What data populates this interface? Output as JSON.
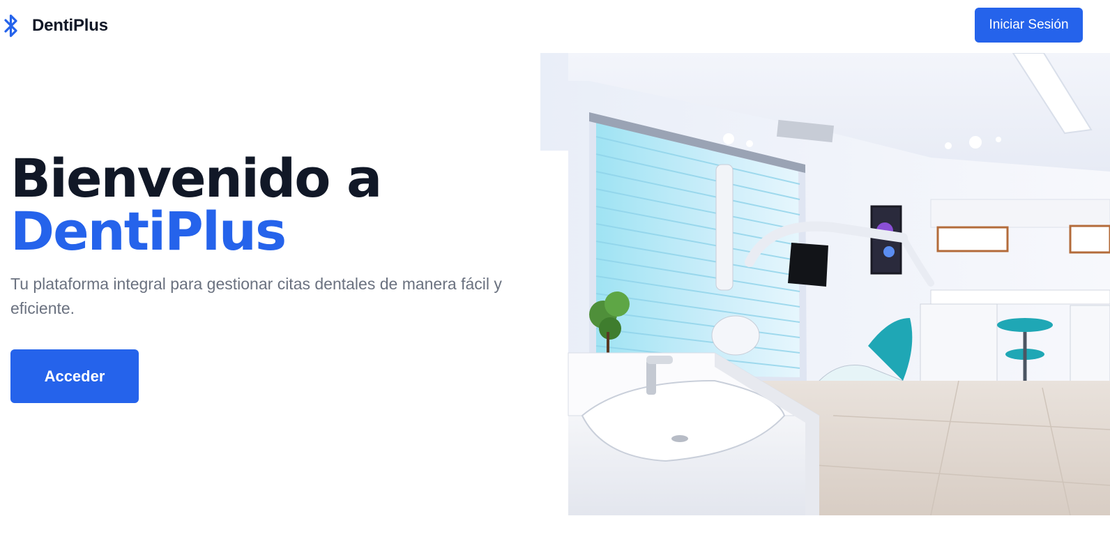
{
  "header": {
    "brand_name": "DentiPlus",
    "brand_icon": "bluetooth-icon",
    "login_label": "Iniciar Sesión"
  },
  "hero": {
    "title_line1": "Bienvenido a",
    "title_line2": "DentiPlus",
    "subtitle": "Tu plataforma integral para gestionar citas dentales de manera fácil y eficiente.",
    "cta_label": "Acceder",
    "image_subject": "dental-clinic-photo"
  },
  "colors": {
    "primary": "#2563eb",
    "heading": "#111827",
    "muted_text": "#6b7280",
    "background": "#ffffff"
  }
}
